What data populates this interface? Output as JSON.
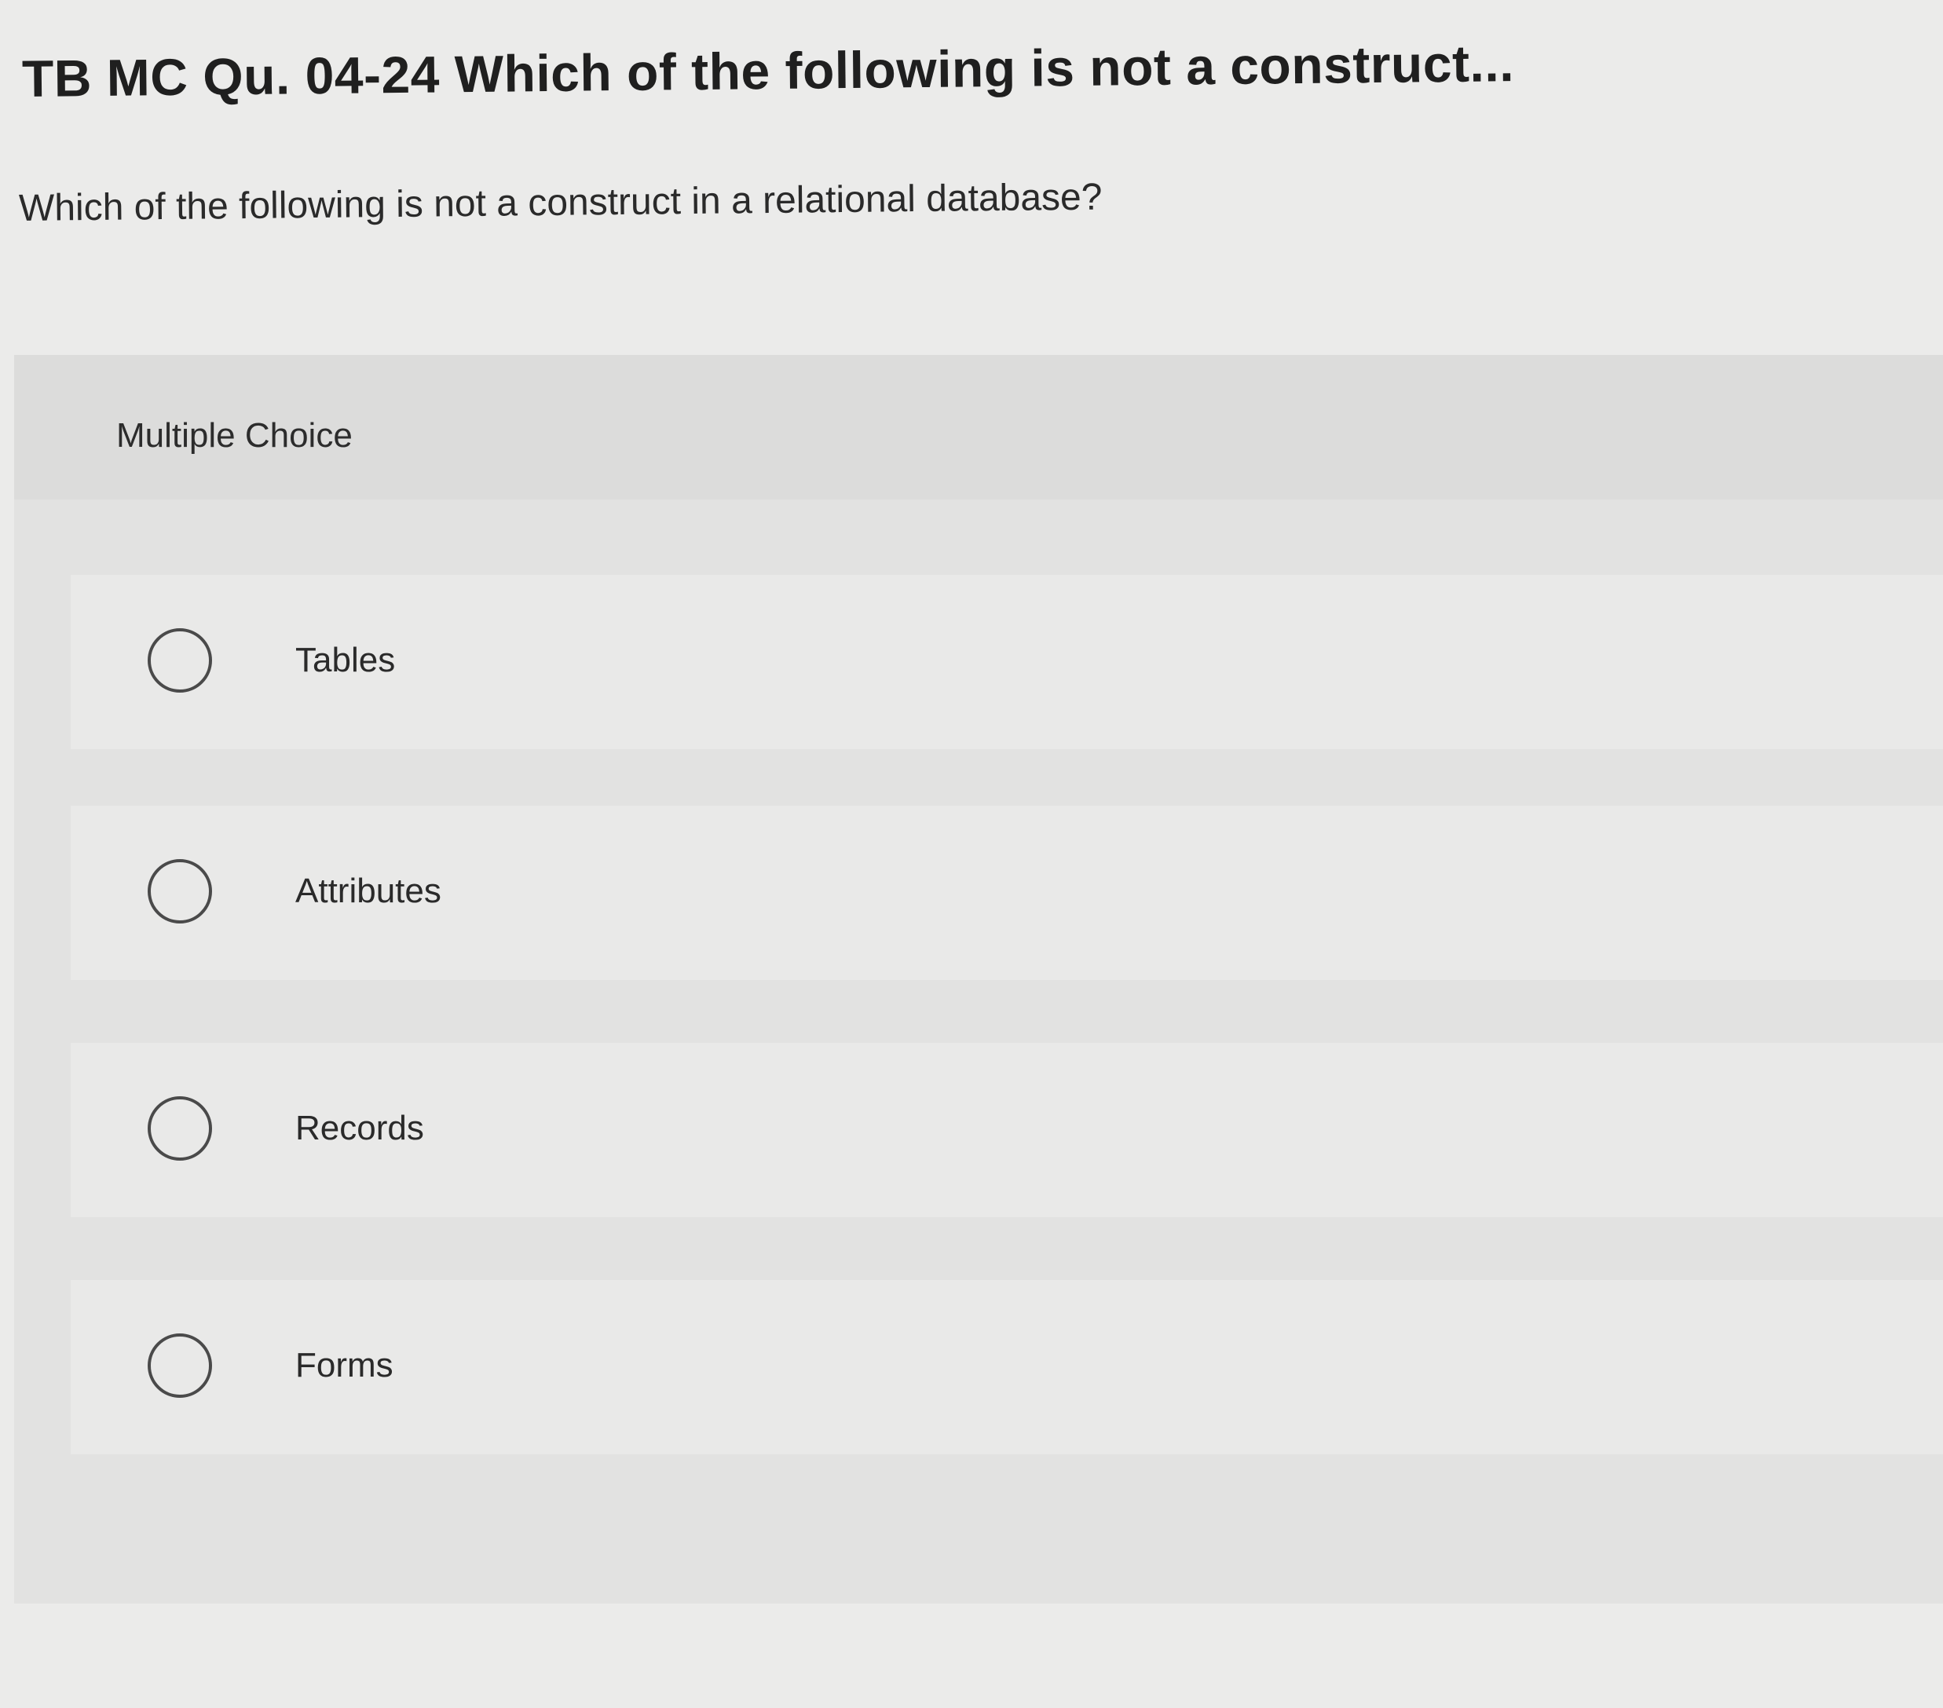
{
  "header": {
    "title": "TB MC Qu. 04-24 Which of the following is not a construct..."
  },
  "question": {
    "text": "Which of the following is not a construct in a relational database?"
  },
  "multiple_choice": {
    "label": "Multiple Choice",
    "options": [
      {
        "label": "Tables",
        "selected": false
      },
      {
        "label": "Attributes",
        "selected": false
      },
      {
        "label": "Records",
        "selected": false
      },
      {
        "label": "Forms",
        "selected": false
      }
    ]
  }
}
